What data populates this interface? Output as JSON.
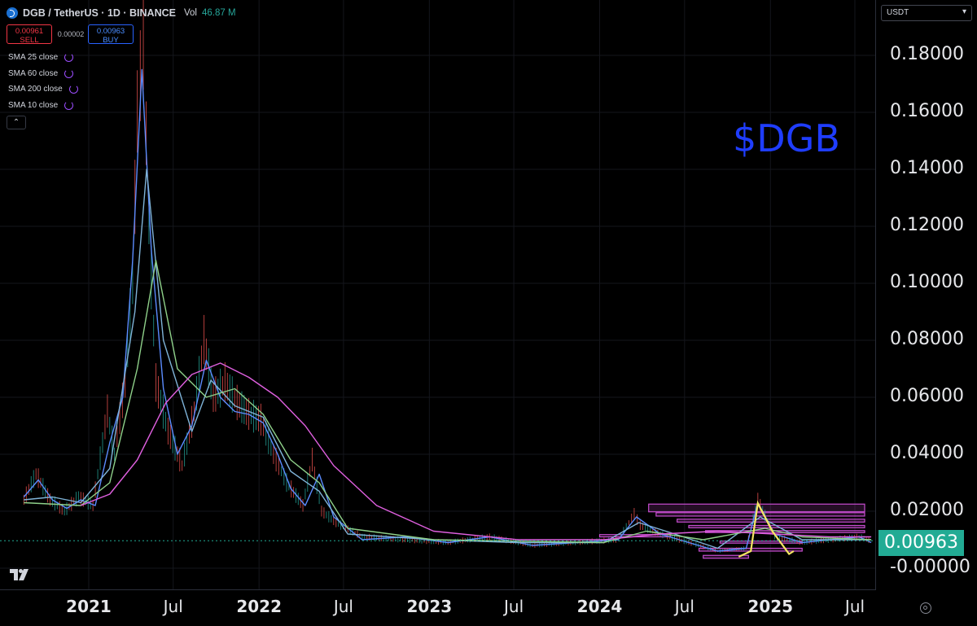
{
  "header": {
    "symbol_title": "DGB / TetherUS · 1D · BINANCE",
    "vol_label": "Vol",
    "vol_value": "46.87 M"
  },
  "trade": {
    "sell_price": "0.00961",
    "sell_label": "SELL",
    "spread": "0.00002",
    "buy_price": "0.00963",
    "buy_label": "BUY"
  },
  "indicators": [
    {
      "label": "SMA 25 close",
      "icon": "refresh-icon"
    },
    {
      "label": "SMA 60 close",
      "icon": "refresh-icon"
    },
    {
      "label": "SMA 200 close",
      "icon": "refresh-icon"
    },
    {
      "label": "SMA 10 close",
      "icon": "refresh-icon"
    }
  ],
  "collapse_icon": "chevron-up-icon",
  "quote_currency": "USDT",
  "annotation_text": "$DGB",
  "last_price": "0.00963",
  "colors": {
    "background": "#000000",
    "up": "#26a69a",
    "down": "#ef5350",
    "sma10": "#5b8cff",
    "sma25": "#7fb3d8",
    "sma60": "#8fd18a",
    "sma200": "#e060e0",
    "zones": "#c64ccf",
    "zigzag": "#f5e663",
    "annotation": "#1f3dff",
    "price_tag": "#22ab94"
  },
  "chart_data": {
    "type": "line",
    "chart_style": "candlestick",
    "title": "DGB / TetherUS · 1D · BINANCE",
    "xlabel": "",
    "ylabel": "",
    "ylim": [
      -0.005,
      0.195
    ],
    "y_ticks": [
      "0.18000",
      "0.16000",
      "0.14000",
      "0.12000",
      "0.10000",
      "0.08000",
      "0.06000",
      "0.04000",
      "0.02000",
      "-0.00000"
    ],
    "x_ticks": [
      "2021",
      "Jul",
      "2022",
      "Jul",
      "2023",
      "Jul",
      "2024",
      "Jul",
      "2025",
      "Jul"
    ],
    "x_tick_dates": [
      "2021-01-01",
      "2021-07-01",
      "2022-01-01",
      "2022-07-01",
      "2023-01-01",
      "2023-07-01",
      "2024-01-01",
      "2024-07-01",
      "2025-01-01",
      "2025-07-01"
    ],
    "x_range": [
      "2020-08-10",
      "2025-08-10"
    ],
    "grid": true,
    "last_value": 0.00963,
    "series": [
      {
        "name": "SMA 10 close",
        "x": [
          "2020-08-15",
          "2020-09-15",
          "2020-10-15",
          "2020-11-15",
          "2020-12-15",
          "2021-01-15",
          "2021-02-15",
          "2021-03-15",
          "2021-04-05",
          "2021-04-25",
          "2021-05-15",
          "2021-06-10",
          "2021-07-10",
          "2021-08-10",
          "2021-09-10",
          "2021-10-10",
          "2021-11-10",
          "2021-12-10",
          "2022-01-10",
          "2022-02-10",
          "2022-03-10",
          "2022-04-10",
          "2022-05-10",
          "2022-06-10",
          "2022-08-10",
          "2022-11-10",
          "2023-02-10",
          "2023-05-10",
          "2023-08-10",
          "2023-11-10",
          "2024-02-10",
          "2024-03-20",
          "2024-05-10",
          "2024-07-10",
          "2024-09-10",
          "2024-11-10",
          "2024-12-05",
          "2025-01-10",
          "2025-03-10",
          "2025-05-10",
          "2025-07-10",
          "2025-08-05"
        ],
        "values": [
          0.025,
          0.031,
          0.024,
          0.021,
          0.024,
          0.022,
          0.044,
          0.06,
          0.108,
          0.175,
          0.112,
          0.063,
          0.04,
          0.05,
          0.073,
          0.06,
          0.055,
          0.054,
          0.051,
          0.04,
          0.028,
          0.022,
          0.033,
          0.018,
          0.01,
          0.011,
          0.009,
          0.011,
          0.008,
          0.009,
          0.01,
          0.018,
          0.012,
          0.009,
          0.006,
          0.007,
          0.023,
          0.012,
          0.009,
          0.01,
          0.011,
          0.009
        ]
      },
      {
        "name": "SMA 25 close",
        "x": [
          "2020-08-15",
          "2020-10-15",
          "2020-12-15",
          "2021-02-15",
          "2021-04-10",
          "2021-05-05",
          "2021-06-10",
          "2021-08-10",
          "2021-09-20",
          "2021-11-10",
          "2022-01-10",
          "2022-03-10",
          "2022-05-10",
          "2022-07-10",
          "2023-01-10",
          "2023-07-10",
          "2024-01-10",
          "2024-03-25",
          "2024-06-10",
          "2024-09-10",
          "2024-12-10",
          "2025-03-10",
          "2025-08-05"
        ],
        "values": [
          0.024,
          0.025,
          0.023,
          0.035,
          0.09,
          0.14,
          0.08,
          0.048,
          0.066,
          0.057,
          0.053,
          0.034,
          0.027,
          0.012,
          0.01,
          0.009,
          0.009,
          0.016,
          0.012,
          0.007,
          0.018,
          0.01,
          0.01
        ]
      },
      {
        "name": "SMA 60 close",
        "x": [
          "2020-08-15",
          "2020-12-15",
          "2021-02-15",
          "2021-04-15",
          "2021-05-25",
          "2021-07-10",
          "2021-09-10",
          "2021-11-10",
          "2022-01-10",
          "2022-03-10",
          "2022-05-10",
          "2022-07-10",
          "2023-01-10",
          "2024-01-10",
          "2024-04-10",
          "2024-08-10",
          "2024-12-20",
          "2025-03-10",
          "2025-08-05"
        ],
        "values": [
          0.023,
          0.022,
          0.03,
          0.07,
          0.108,
          0.07,
          0.06,
          0.063,
          0.054,
          0.038,
          0.03,
          0.014,
          0.01,
          0.009,
          0.013,
          0.01,
          0.014,
          0.011,
          0.01
        ]
      },
      {
        "name": "SMA 200 close",
        "x": [
          "2020-12-15",
          "2021-02-15",
          "2021-04-15",
          "2021-06-15",
          "2021-08-10",
          "2021-10-10",
          "2021-12-10",
          "2022-02-10",
          "2022-04-10",
          "2022-06-10",
          "2022-09-10",
          "2023-01-10",
          "2023-07-10",
          "2024-01-10",
          "2024-05-10",
          "2024-09-10",
          "2025-01-10",
          "2025-05-10",
          "2025-08-05"
        ],
        "values": [
          0.022,
          0.026,
          0.038,
          0.058,
          0.068,
          0.072,
          0.067,
          0.06,
          0.05,
          0.036,
          0.022,
          0.013,
          0.01,
          0.01,
          0.012,
          0.013,
          0.012,
          0.011,
          0.011
        ]
      },
      {
        "name": "Close",
        "x": [
          "2020-08-15",
          "2020-09-10",
          "2020-10-10",
          "2020-11-10",
          "2020-12-10",
          "2021-01-10",
          "2021-02-10",
          "2021-02-25",
          "2021-03-20",
          "2021-04-05",
          "2021-04-15",
          "2021-04-28",
          "2021-05-10",
          "2021-05-25",
          "2021-06-20",
          "2021-07-20",
          "2021-08-15",
          "2021-09-05",
          "2021-09-25",
          "2021-10-20",
          "2021-11-15",
          "2021-12-10",
          "2022-01-05",
          "2022-02-01",
          "2022-03-01",
          "2022-04-05",
          "2022-04-25",
          "2022-05-15",
          "2022-06-15",
          "2022-08-10",
          "2022-11-10",
          "2023-02-10",
          "2023-05-10",
          "2023-08-10",
          "2023-11-10",
          "2024-02-10",
          "2024-03-15",
          "2024-03-28",
          "2024-05-10",
          "2024-07-10",
          "2024-09-10",
          "2024-11-10",
          "2024-12-05",
          "2025-01-10",
          "2025-03-10",
          "2025-05-10",
          "2025-07-10",
          "2025-08-05"
        ],
        "values": [
          0.024,
          0.033,
          0.024,
          0.02,
          0.025,
          0.022,
          0.055,
          0.04,
          0.065,
          0.1,
          0.16,
          0.185,
          0.12,
          0.065,
          0.048,
          0.036,
          0.055,
          0.08,
          0.06,
          0.065,
          0.058,
          0.054,
          0.052,
          0.04,
          0.03,
          0.022,
          0.038,
          0.02,
          0.016,
          0.011,
          0.01,
          0.009,
          0.011,
          0.008,
          0.009,
          0.01,
          0.019,
          0.015,
          0.012,
          0.009,
          0.006,
          0.007,
          0.024,
          0.011,
          0.009,
          0.01,
          0.011,
          0.0096
        ]
      }
    ],
    "zones": [
      {
        "from": "2024-04-15",
        "to": "2025-08-05",
        "top": 0.0225,
        "bottom": 0.0198
      },
      {
        "from": "2024-05-01",
        "to": "2025-08-05",
        "top": 0.0195,
        "bottom": 0.0183
      },
      {
        "from": "2024-06-15",
        "to": "2025-08-05",
        "top": 0.0172,
        "bottom": 0.0162
      },
      {
        "from": "2024-07-10",
        "to": "2025-08-05",
        "top": 0.015,
        "bottom": 0.0142
      },
      {
        "from": "2024-08-15",
        "to": "2025-08-05",
        "top": 0.0132,
        "bottom": 0.0125
      },
      {
        "from": "2024-01-01",
        "to": "2024-06-01",
        "top": 0.0118,
        "bottom": 0.011
      },
      {
        "from": "2024-09-15",
        "to": "2025-03-10",
        "top": 0.0095,
        "bottom": 0.0088
      },
      {
        "from": "2024-08-01",
        "to": "2025-03-10",
        "top": 0.007,
        "bottom": 0.006
      },
      {
        "from": "2024-08-10",
        "to": "2024-11-15",
        "top": 0.0045,
        "bottom": 0.0035
      }
    ],
    "zigzag": {
      "x": [
        "2024-10-25",
        "2024-11-20",
        "2024-12-05",
        "2025-01-05",
        "2025-02-10",
        "2025-02-20"
      ],
      "values": [
        0.004,
        0.006,
        0.0228,
        0.013,
        0.005,
        0.006
      ]
    }
  }
}
